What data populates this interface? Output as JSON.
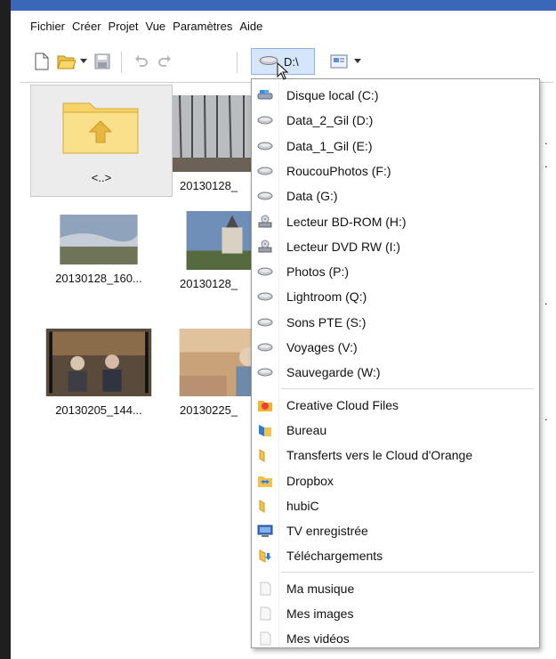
{
  "menu": {
    "items": [
      "Fichier",
      "Créer",
      "Projet",
      "Vue",
      "Paramètres",
      "Aide"
    ]
  },
  "toolbar": {
    "icons": [
      "new-file-icon",
      "open-folder-icon",
      "dropdown-arrow-icon",
      "save-icon",
      "undo-icon",
      "redo-icon",
      "drive-icon",
      "view-icon"
    ],
    "drive_label": "D:\\"
  },
  "browser": {
    "folder_label": "<..>",
    "thumbnails": [
      {
        "caption": "20130128_"
      },
      {
        "caption": "20130128_160..."
      },
      {
        "caption": "20130128_"
      },
      {
        "caption": "20130205_144..."
      },
      {
        "caption": "20130225_"
      }
    ]
  },
  "dropdown": {
    "drives": [
      {
        "label": "Disque local (C:)",
        "icon": "system-drive-icon"
      },
      {
        "label": "Data_2_Gil (D:)",
        "icon": "drive-icon"
      },
      {
        "label": "Data_1_Gil (E:)",
        "icon": "drive-icon"
      },
      {
        "label": "RoucouPhotos (F:)",
        "icon": "drive-icon"
      },
      {
        "label": "Data (G:)",
        "icon": "drive-icon"
      },
      {
        "label": "Lecteur BD-ROM (H:)",
        "icon": "optical-drive-icon"
      },
      {
        "label": "Lecteur DVD RW (I:)",
        "icon": "optical-drive-icon"
      },
      {
        "label": "Photos (P:)",
        "icon": "drive-icon"
      },
      {
        "label": "Lightroom (Q:)",
        "icon": "drive-icon"
      },
      {
        "label": "Sons  PTE (S:)",
        "icon": "drive-icon"
      },
      {
        "label": "Voyages (V:)",
        "icon": "drive-icon"
      },
      {
        "label": "Sauvegarde (W:)",
        "icon": "drive-icon"
      }
    ],
    "places": [
      {
        "label": "Creative Cloud Files",
        "icon": "creative-cloud-icon"
      },
      {
        "label": "Bureau",
        "icon": "desktop-folder-icon"
      },
      {
        "label": "Transferts vers le Cloud d'Orange",
        "icon": "folder-icon"
      },
      {
        "label": "Dropbox",
        "icon": "dropbox-folder-icon"
      },
      {
        "label": "hubiC",
        "icon": "folder-icon"
      },
      {
        "label": "TV enregistrée",
        "icon": "tv-icon"
      },
      {
        "label": "Téléchargements",
        "icon": "downloads-folder-icon"
      }
    ],
    "libraries": [
      {
        "label": "Ma musique",
        "icon": "library-icon"
      },
      {
        "label": "Mes images",
        "icon": "library-icon"
      },
      {
        "label": "Mes vidéos",
        "icon": "library-icon"
      }
    ]
  }
}
